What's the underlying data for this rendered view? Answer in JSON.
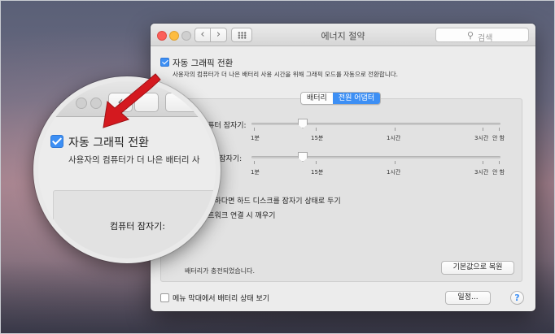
{
  "window": {
    "title": "에너지 절약",
    "search_placeholder": "검색",
    "nav_back": "‹",
    "nav_forward": "›"
  },
  "auto_switch": {
    "checked": true,
    "label": "자동 그래픽 전환",
    "description": "사용자의 컴퓨터가 더 나은 배터리 사용 시간을 위해 그래픽 모드를 자동으로 전환합니다."
  },
  "tabs": [
    {
      "label": "배터리",
      "selected": false
    },
    {
      "label": "전원 어댑터",
      "selected": true
    }
  ],
  "sliders": [
    {
      "label": "컴퓨터 잠자기:",
      "value_minutes": 10
    },
    {
      "label": "디스플레이 잠자기:",
      "value_minutes": 10
    }
  ],
  "tick_labels": {
    "t1": "1분",
    "t15": "15분",
    "t1h": "1시간",
    "t3h": "3시간",
    "never": "안 함"
  },
  "options": [
    {
      "label": "가능하다면 하드 디스크를 잠자기 상태로 두기"
    },
    {
      "label": "네트워크 연결 시 깨우기"
    }
  ],
  "status_text": "배터리가 충전되었습니다.",
  "buttons": {
    "restore_defaults": "기본값으로 복원",
    "schedule": "일정...",
    "help": "?"
  },
  "menubar_option": {
    "checked": false,
    "label": "메뉴 막대에서 배터리 상태 보기"
  },
  "magnifier": {
    "label": "자동 그래픽 전환",
    "description": "사용자의 컴퓨터가 더 나은 배터리 사",
    "row_label": "컴퓨터 잠자기:",
    "nav_back": "‹"
  },
  "colors": {
    "accent": "#3d8ff4",
    "arrow": "#d4191f"
  }
}
